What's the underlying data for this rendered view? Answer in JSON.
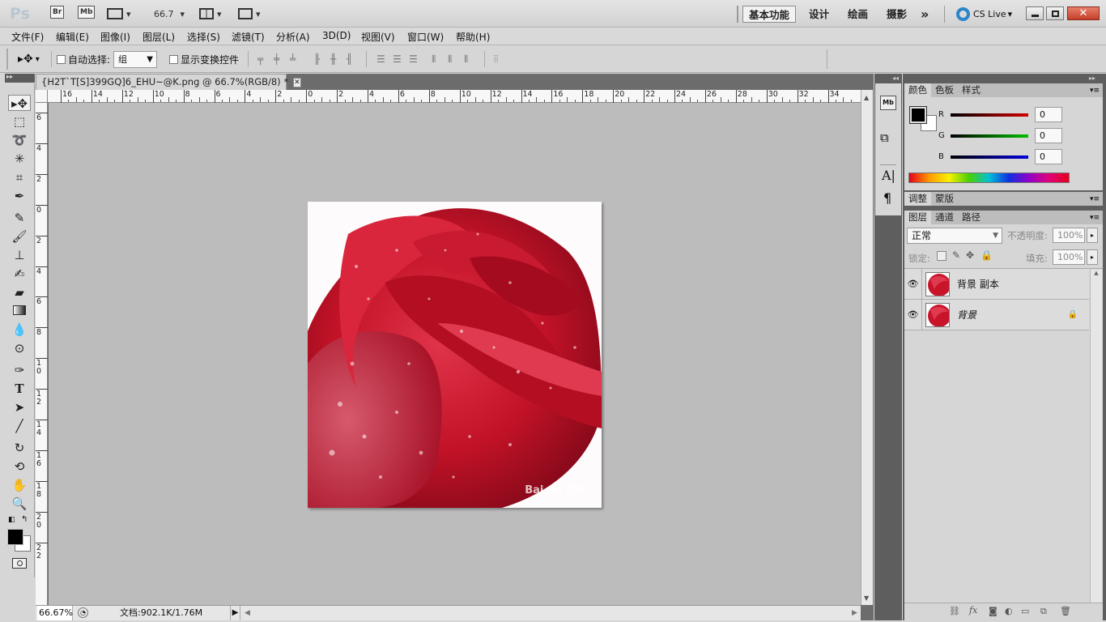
{
  "app": {
    "logo": "Ps",
    "bridge": "Br",
    "mini_bridge": "Mb",
    "zoom_value": "66.7",
    "workspaces": [
      "基本功能",
      "设计",
      "绘画",
      "摄影"
    ],
    "more": "»",
    "cs_live": "CS Live"
  },
  "menu": [
    "文件(F)",
    "编辑(E)",
    "图像(I)",
    "图层(L)",
    "选择(S)",
    "滤镜(T)",
    "分析(A)",
    "3D(D)",
    "视图(V)",
    "窗口(W)",
    "帮助(H)"
  ],
  "options": {
    "auto_select_label": "自动选择:",
    "auto_select_value": "组",
    "show_transform_label": "显示变换控件"
  },
  "document": {
    "tab_title": "{H2T`T[S]399GQ]6_EHU~@K.png @ 66.7%(RGB/8) *",
    "ruler_h_labels": [
      "16",
      "14",
      "12",
      "10",
      "8",
      "6",
      "4",
      "2",
      "0",
      "2",
      "4",
      "6",
      "8",
      "10",
      "12",
      "14",
      "16",
      "18",
      "20",
      "22",
      "24",
      "26",
      "28",
      "30",
      "32",
      "34"
    ],
    "ruler_v_labels": [
      "6",
      "4",
      "2",
      "0",
      "2",
      "4",
      "6",
      "8",
      "1 0",
      "1 2",
      "1 4",
      "1 6",
      "1 8",
      "2 0",
      "2 2"
    ],
    "watermark": "Bai du 百科"
  },
  "status": {
    "zoom": "66.67%",
    "doc_info": "文档:902.1K/1.76M"
  },
  "color_panel": {
    "tabs": [
      "颜色",
      "色板",
      "样式"
    ],
    "channels": [
      {
        "label": "R",
        "value": "0",
        "color": "#d40000"
      },
      {
        "label": "G",
        "value": "0",
        "color": "#00b000"
      },
      {
        "label": "B",
        "value": "0",
        "color": "#0000d0"
      }
    ],
    "foreground": "#000000",
    "background": "#ffffff"
  },
  "adjust_panel": {
    "tabs": [
      "调整",
      "蒙版"
    ]
  },
  "layers_panel": {
    "tabs": [
      "图层",
      "通道",
      "路径"
    ],
    "blend_mode": "正常",
    "opacity_label": "不透明度:",
    "opacity_value": "100%",
    "lock_label": "锁定:",
    "fill_label": "填充:",
    "fill_value": "100%",
    "layers": [
      {
        "name": "背景 副本",
        "locked": false
      },
      {
        "name": "背景",
        "locked": true
      }
    ]
  },
  "colors": {
    "canvas_bg": "#bcbcbc",
    "rose_red": "#c8152a"
  }
}
